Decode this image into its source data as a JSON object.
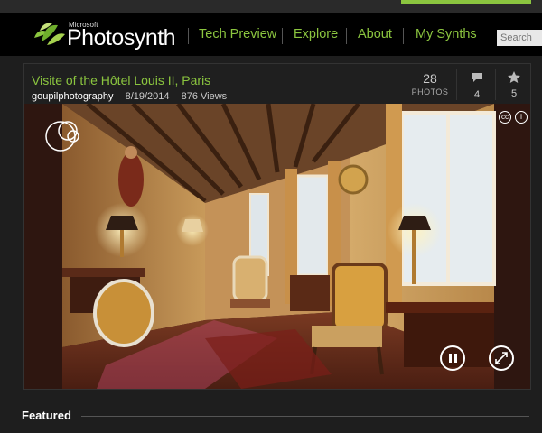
{
  "brand": {
    "company": "Microsoft",
    "product": "Photosynth"
  },
  "nav": [
    {
      "label": "Tech Preview"
    },
    {
      "label": "Explore"
    },
    {
      "label": "About"
    },
    {
      "label": "My Synths"
    }
  ],
  "search": {
    "placeholder": "Search"
  },
  "synth": {
    "title": "Visite of the Hôtel Louis II, Paris",
    "user": "goupilphotography",
    "date": "8/19/2014",
    "views": "876 Views",
    "photos_count": "28",
    "photos_label": "PHOTOS",
    "comments_count": "4",
    "favorites_count": "5"
  },
  "viewer_icons": [
    "cc-icon",
    "info-icon",
    "pause-icon",
    "fullscreen-icon",
    "nav-circles-icon"
  ],
  "section": {
    "featured": "Featured"
  },
  "colors": {
    "accent": "#8bc53f",
    "background": "#1e1e1e",
    "navbar": "#000000"
  }
}
